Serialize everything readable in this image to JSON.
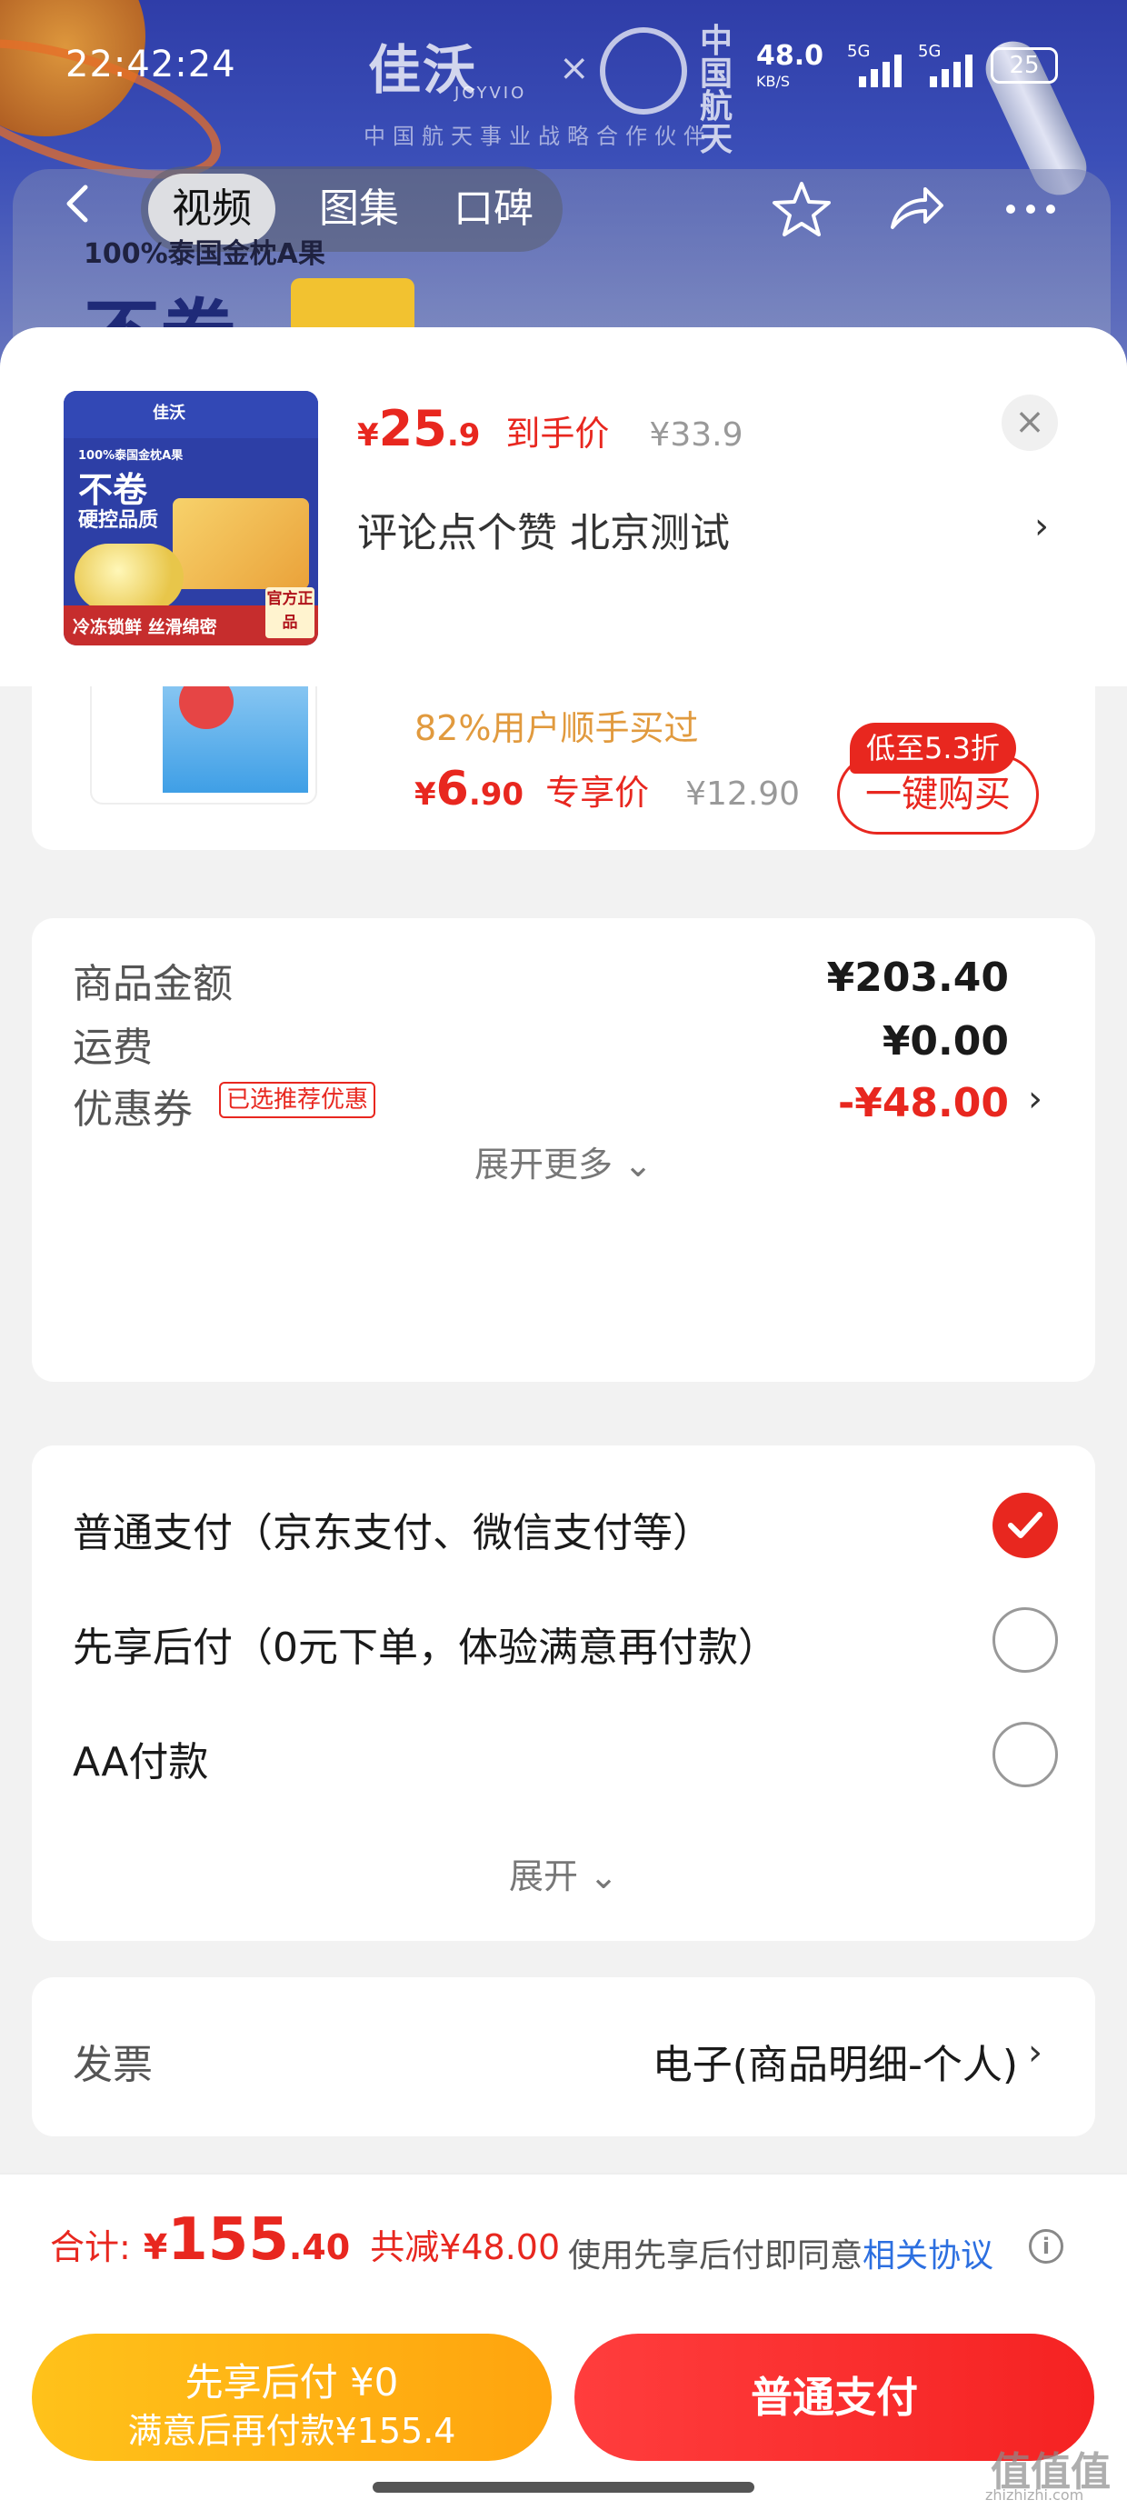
{
  "status": {
    "time": "22:42:24",
    "net_speed": "48.0",
    "net_unit": "KB/S",
    "sig1": "5G",
    "sig2": "5G",
    "battery": "25"
  },
  "background": {
    "brand": "佳沃",
    "brand_en": "JOYVIO",
    "brand_partner_name": "中国航天",
    "partner_text": "中国航天事业战略合作伙伴",
    "promo_small": "100%泰国金枕A果",
    "promo_big": "不卷"
  },
  "nav": {
    "tabs": [
      {
        "label": "视频",
        "active": true
      },
      {
        "label": "图集",
        "active": false
      },
      {
        "label": "口碑",
        "active": false
      }
    ],
    "icons": [
      "back-icon",
      "star-icon",
      "share-icon",
      "more-icon"
    ]
  },
  "sheet": {
    "product": {
      "thumb_brand": "佳沃",
      "thumb_tagline": "100%泰国金枕A果",
      "thumb_headline": "不卷",
      "thumb_sub": "硬控品质",
      "thumb_bottom": "冷冻锁鲜 丝滑绵密",
      "thumb_official": "官方正品",
      "price_currency": "¥",
      "price_int": "25",
      "price_dec": ".9",
      "price_label": "到手价",
      "orig_price": "¥33.9",
      "sku_text": "评论点个赞  北京测试",
      "close_label": "×"
    },
    "recommend": {
      "stat": "82%用户顺手买过",
      "price_currency": "¥",
      "price_int": "6",
      "price_dec": ".90",
      "price_label": "专享价",
      "orig_price": "¥12.90",
      "discount_tag": "低至5.3折",
      "buy_label": "一键购买"
    },
    "amounts": {
      "rows": [
        {
          "label": "商品金额",
          "value": "¥203.40"
        },
        {
          "label": "运费",
          "value": "¥0.00"
        },
        {
          "label": "优惠券",
          "value": "-¥48.00",
          "tag": "已选推荐优惠"
        }
      ],
      "expand_label": "展开更多 ⌄"
    },
    "payment": {
      "options": [
        {
          "label": "普通支付（京东支付、微信支付等）",
          "checked": true
        },
        {
          "label": "先享后付（0元下单，体验满意再付款）",
          "checked": false
        },
        {
          "label": "AA付款",
          "checked": false
        }
      ],
      "expand_label": "展开 ⌄"
    },
    "invoice": {
      "label": "发票",
      "value": "电子(商品明细-个人)"
    }
  },
  "bottom": {
    "total_label": "合计:",
    "total_currency": "¥",
    "total_int": "155",
    "total_dec": ".40",
    "saved": "共减¥48.00",
    "agree_prefix": "使用先享后付即同意",
    "agree_link": "相关协议",
    "bnpl_line1": "先享后付 ¥0",
    "bnpl_line2": "满意后再付款¥155.4",
    "pay_label": "普通支付"
  },
  "watermark": {
    "text": "值值值",
    "url": "zhizhizhi.com"
  },
  "colors": {
    "accent": "#e8271f",
    "bnpl": "#ffb014",
    "link": "#2c6fe0",
    "stat": "#e19a3e"
  }
}
